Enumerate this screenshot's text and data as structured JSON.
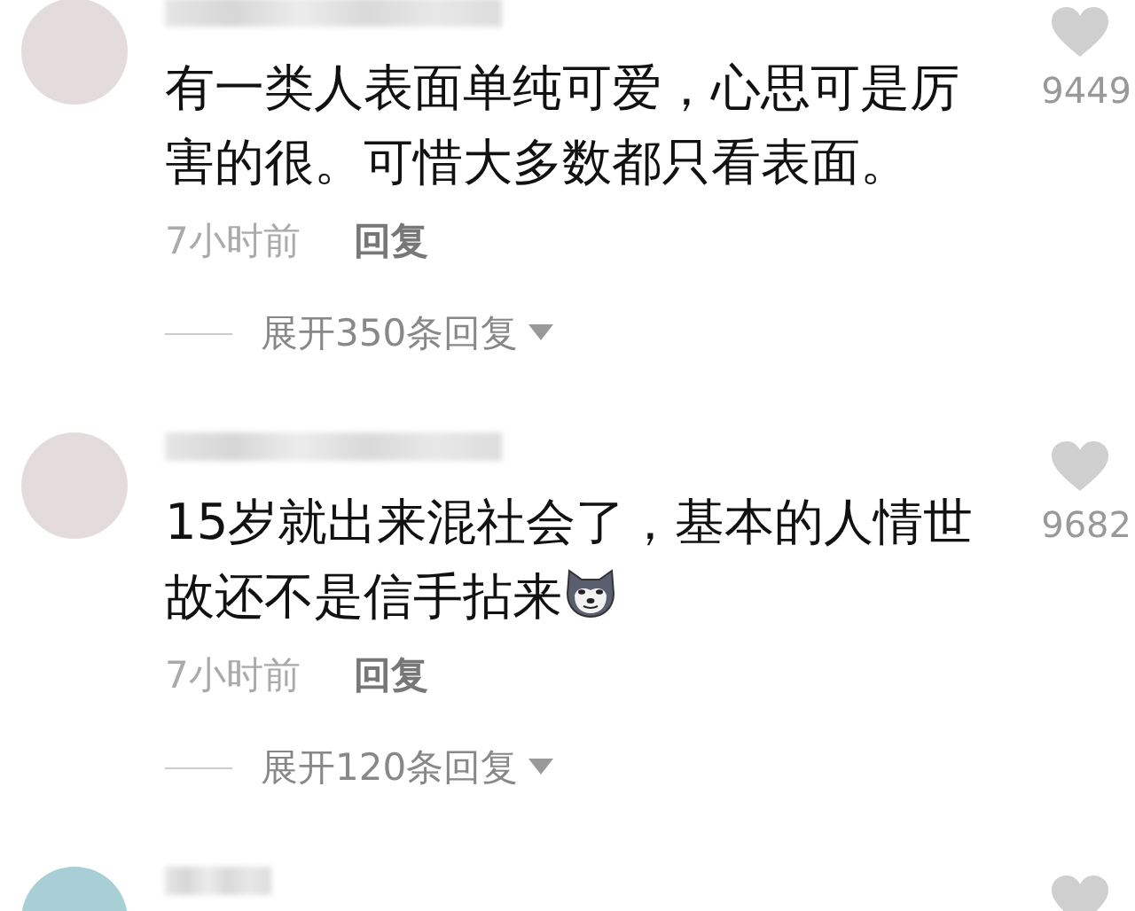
{
  "comments": [
    {
      "kind": "full",
      "text": "有一类人表面单纯可爱，心思可是厉害的很。可惜大多数都只看表面。",
      "likes": "9449",
      "time": "7小时前",
      "reply": "回复",
      "expand": "展开350条回复"
    },
    {
      "kind": "full",
      "text": "15岁就出来混社会了，基本的人情世故还不是信手拈来",
      "trailing_emoji": {
        "kind": "dog_face"
      },
      "likes": "9682",
      "time": "7小时前",
      "reply": "回复",
      "expand": "展开120条回复"
    },
    {
      "kind": "cut_off"
    }
  ]
}
